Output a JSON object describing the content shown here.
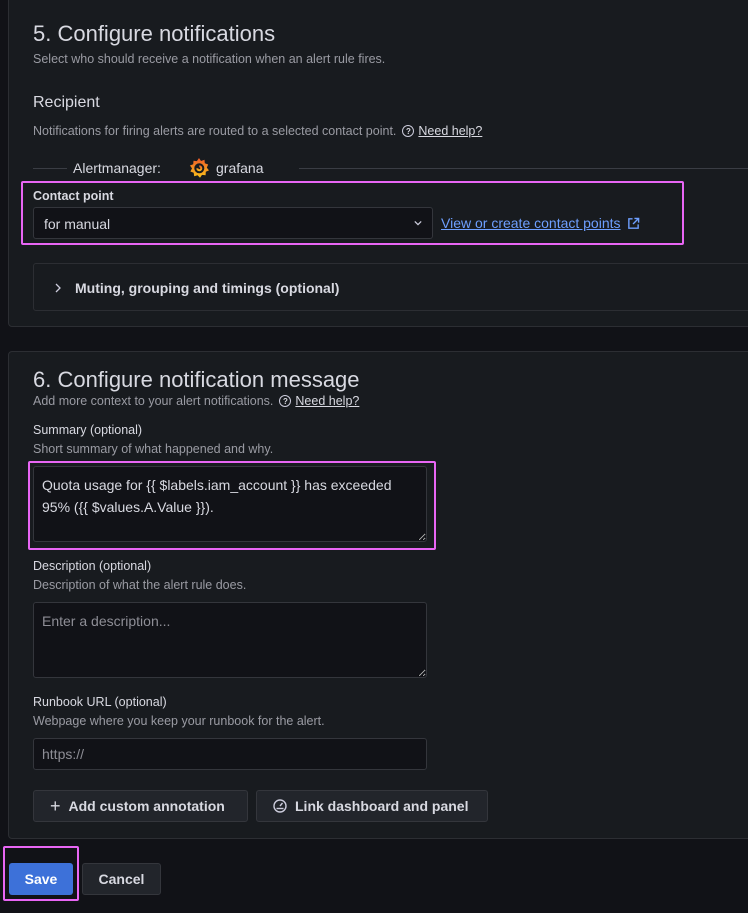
{
  "section5": {
    "title": "5. Configure notifications",
    "subtitle": "Select who should receive a notification when an alert rule fires.",
    "recipient_heading": "Recipient",
    "recipient_desc": "Notifications for firing alerts are routed to a selected contact point.",
    "help_link": "Need help?",
    "alertmanager_label": "Alertmanager:",
    "alertmanager_name": "grafana",
    "contact_point_label": "Contact point",
    "contact_point_value": "for manual",
    "contact_point_link": "View or create contact points",
    "muting_label": "Muting, grouping and timings (optional)"
  },
  "section6": {
    "title": "6. Configure notification message",
    "subtitle": "Add more context to your alert notifications.",
    "help_link": "Need help?",
    "summary_label": "Summary (optional)",
    "summary_desc": "Short summary of what happened and why.",
    "summary_value": "Quota usage for {{ $labels.iam_account }} has exceeded 95% ({{ $values.A.Value }}).",
    "description_label": "Description (optional)",
    "description_desc": "Description of what the alert rule does.",
    "description_placeholder": "Enter a description...",
    "runbook_label": "Runbook URL (optional)",
    "runbook_desc": "Webpage where you keep your runbook for the alert.",
    "runbook_placeholder": "https://",
    "add_annotation_button": "Add custom annotation",
    "link_dashboard_button": "Link dashboard and panel"
  },
  "footer": {
    "save_button": "Save",
    "cancel_button": "Cancel"
  },
  "colors": {
    "background": "#111217",
    "panel": "#181b1f",
    "primary": "#3d71d9",
    "link": "#6e9fff",
    "highlight": "#e866f4",
    "grafana_orange": "#f46800"
  }
}
